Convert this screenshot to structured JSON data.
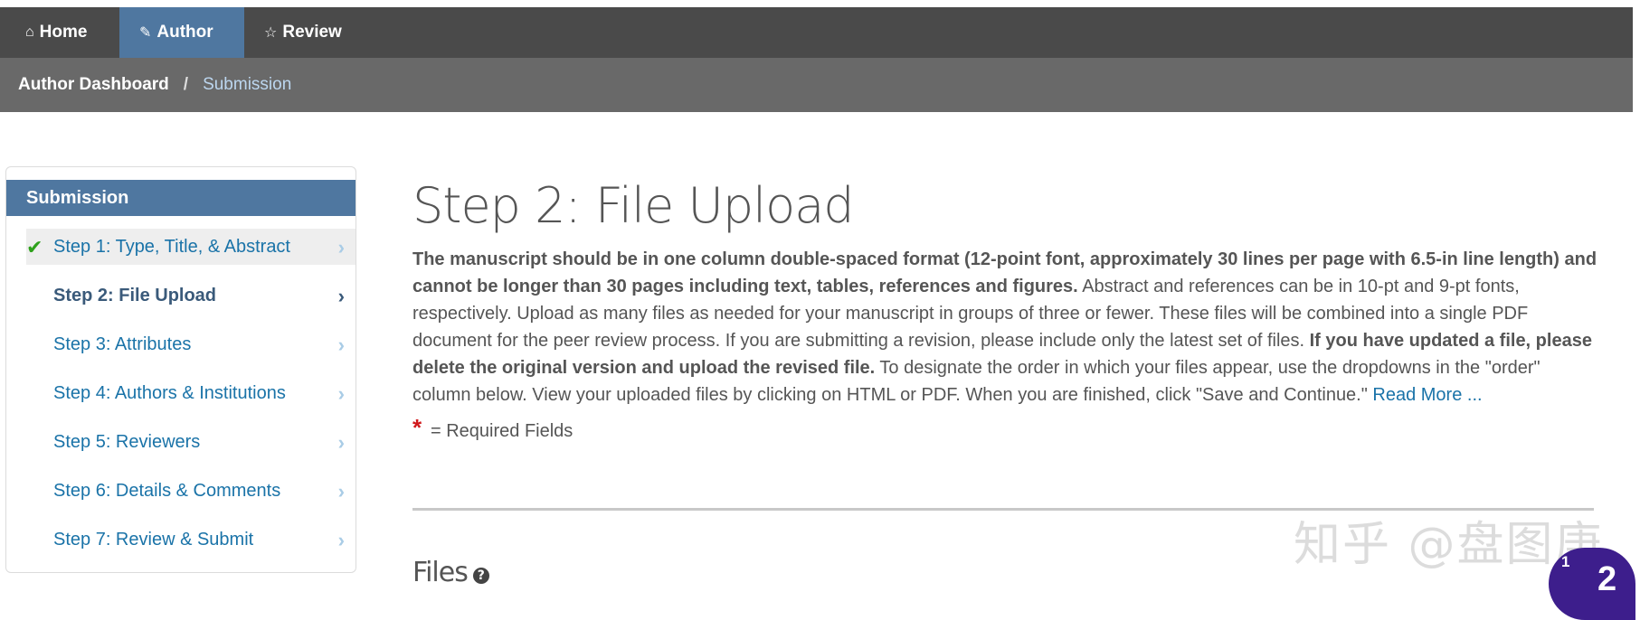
{
  "nav": {
    "tabs": [
      {
        "label": "Home",
        "icon": "home-icon",
        "glyph": "⌂"
      },
      {
        "label": "Author",
        "icon": "pencil-icon",
        "glyph": "✎"
      },
      {
        "label": "Review",
        "icon": "comment-icon",
        "glyph": "☆"
      }
    ],
    "active_tab": "Author"
  },
  "breadcrumb": {
    "root": "Author Dashboard",
    "separator": "/",
    "current": "Submission"
  },
  "sidebar": {
    "title": "Submission",
    "steps": [
      {
        "label": "Step 1: Type, Title, & Abstract",
        "status": "complete"
      },
      {
        "label": "Step 2: File Upload",
        "status": "current"
      },
      {
        "label": "Step 3: Attributes",
        "status": "pending"
      },
      {
        "label": "Step 4: Authors & Institutions",
        "status": "pending"
      },
      {
        "label": "Step 5: Reviewers",
        "status": "pending"
      },
      {
        "label": "Step 6: Details & Comments",
        "status": "pending"
      },
      {
        "label": "Step 7: Review & Submit",
        "status": "pending"
      }
    ],
    "check_glyph": "✔",
    "chevron_glyph": "›"
  },
  "main": {
    "title": "Step 2: File Upload",
    "desc_bold1": "The manuscript should be in one column double-spaced format (12-point font, approximately 30 lines per page with 6.5-in line length) and cannot be longer than 30 pages including text, tables, references and figures.",
    "desc_text1": " Abstract and references can be in 10-pt and 9-pt fonts, respectively. Upload as many files as needed for your manuscript in groups of three or fewer. These files will be combined into a single PDF document for the peer review process. If you are submitting a revision, please include only the latest set of files. ",
    "desc_bold2": "If you have updated a file, please delete the original version and upload the revised file.",
    "desc_text2": " To designate the order in which your files appear, use the dropdowns in the \"order\" column below. View your uploaded files by clicking on HTML or PDF. When you are finished, click \"Save and Continue.\" ",
    "read_more": "Read More ...",
    "required_star": "*",
    "required_text": "= Required Fields",
    "files_heading": "Files",
    "help_glyph": "?"
  },
  "watermark": "知乎 @盘图庚",
  "chat": {
    "count": "1",
    "glyph": "2"
  },
  "colors": {
    "topbar": "#4a4a4a",
    "active_tab": "#4f77a0",
    "breadcrumb_bar": "#696969",
    "link": "#1a73a8",
    "check": "#2ea11b",
    "required": "#d0181b",
    "chat": "#3d1e8c"
  }
}
